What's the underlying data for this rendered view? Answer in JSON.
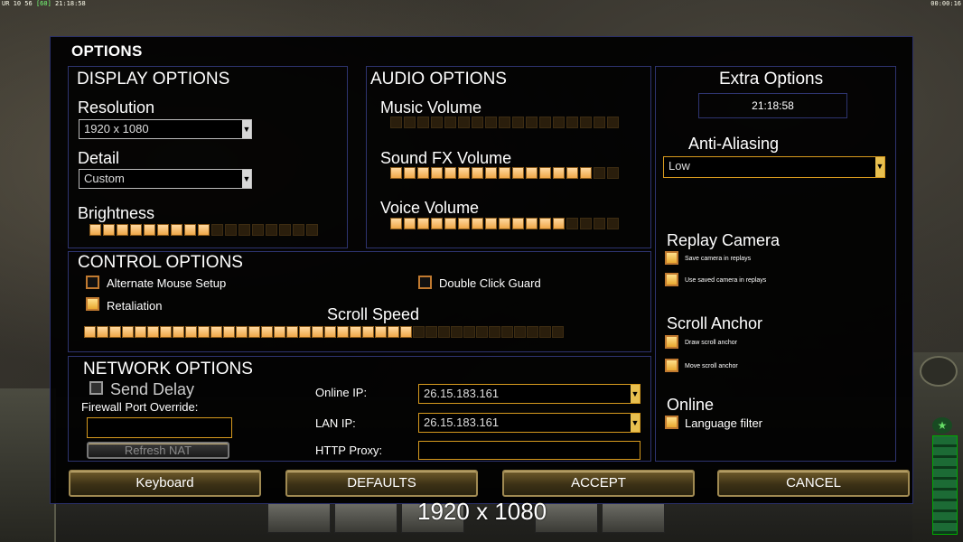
{
  "hud": {
    "left_prefix": "UR 10 56",
    "left_fps": "[60]",
    "left_time": "21:18:58",
    "right_time": "00:00:16"
  },
  "window": {
    "title": "OPTIONS"
  },
  "display": {
    "title": "DISPLAY OPTIONS",
    "resolution_label": "Resolution",
    "resolution_value": "1920 x 1080",
    "detail_label": "Detail",
    "detail_value": "Custom",
    "brightness_label": "Brightness",
    "brightness_level": 9,
    "brightness_total": 17
  },
  "audio": {
    "title": "AUDIO OPTIONS",
    "music_label": "Music Volume",
    "music_level": 0,
    "sfx_label": "Sound FX Volume",
    "sfx_level": 15,
    "voice_label": "Voice Volume",
    "voice_level": 13,
    "total": 17
  },
  "extra": {
    "title": "Extra Options",
    "clock": "21:18:58",
    "aa_label": "Anti-Aliasing",
    "aa_value": "Low",
    "replay_title": "Replay Camera",
    "replay_opt1": "Save camera in replays",
    "replay_opt2": "Use saved camera in replays",
    "scroll_title": "Scroll Anchor",
    "scroll_opt1": "Draw scroll anchor",
    "scroll_opt2": "Move scroll anchor",
    "online_title": "Online",
    "online_opt1": "Language filter"
  },
  "control": {
    "title": "CONTROL OPTIONS",
    "alt_mouse": "Alternate Mouse Setup",
    "double_click": "Double Click Guard",
    "retaliation": "Retaliation",
    "scroll_speed_label": "Scroll Speed",
    "scroll_speed_level": 26,
    "scroll_speed_total": 38
  },
  "network": {
    "title": "NETWORK OPTIONS",
    "send_delay": "Send Delay",
    "firewall_label": "Firewall Port Override:",
    "firewall_value": "",
    "refresh_nat": "Refresh NAT",
    "online_ip_label": "Online IP:",
    "online_ip_value": "26.15.183.161",
    "lan_ip_label": "LAN IP:",
    "lan_ip_value": "26.15.183.161",
    "http_proxy_label": "HTTP Proxy:",
    "http_proxy_value": ""
  },
  "buttons": {
    "keyboard": "Keyboard",
    "defaults": "DEFAULTS",
    "accept": "ACCEPT",
    "cancel": "CANCEL"
  },
  "overlay": {
    "resolution": "1920 x 1080"
  },
  "colors": {
    "slider_on": "#f0a848",
    "slider_off": "#2a1e0c",
    "panel_border": "#2e3470",
    "gold_border": "#d79a1e"
  },
  "icons": {
    "dropdown": "chevron-down-icon",
    "radar": "radar-icon",
    "rank": "star-icon"
  }
}
